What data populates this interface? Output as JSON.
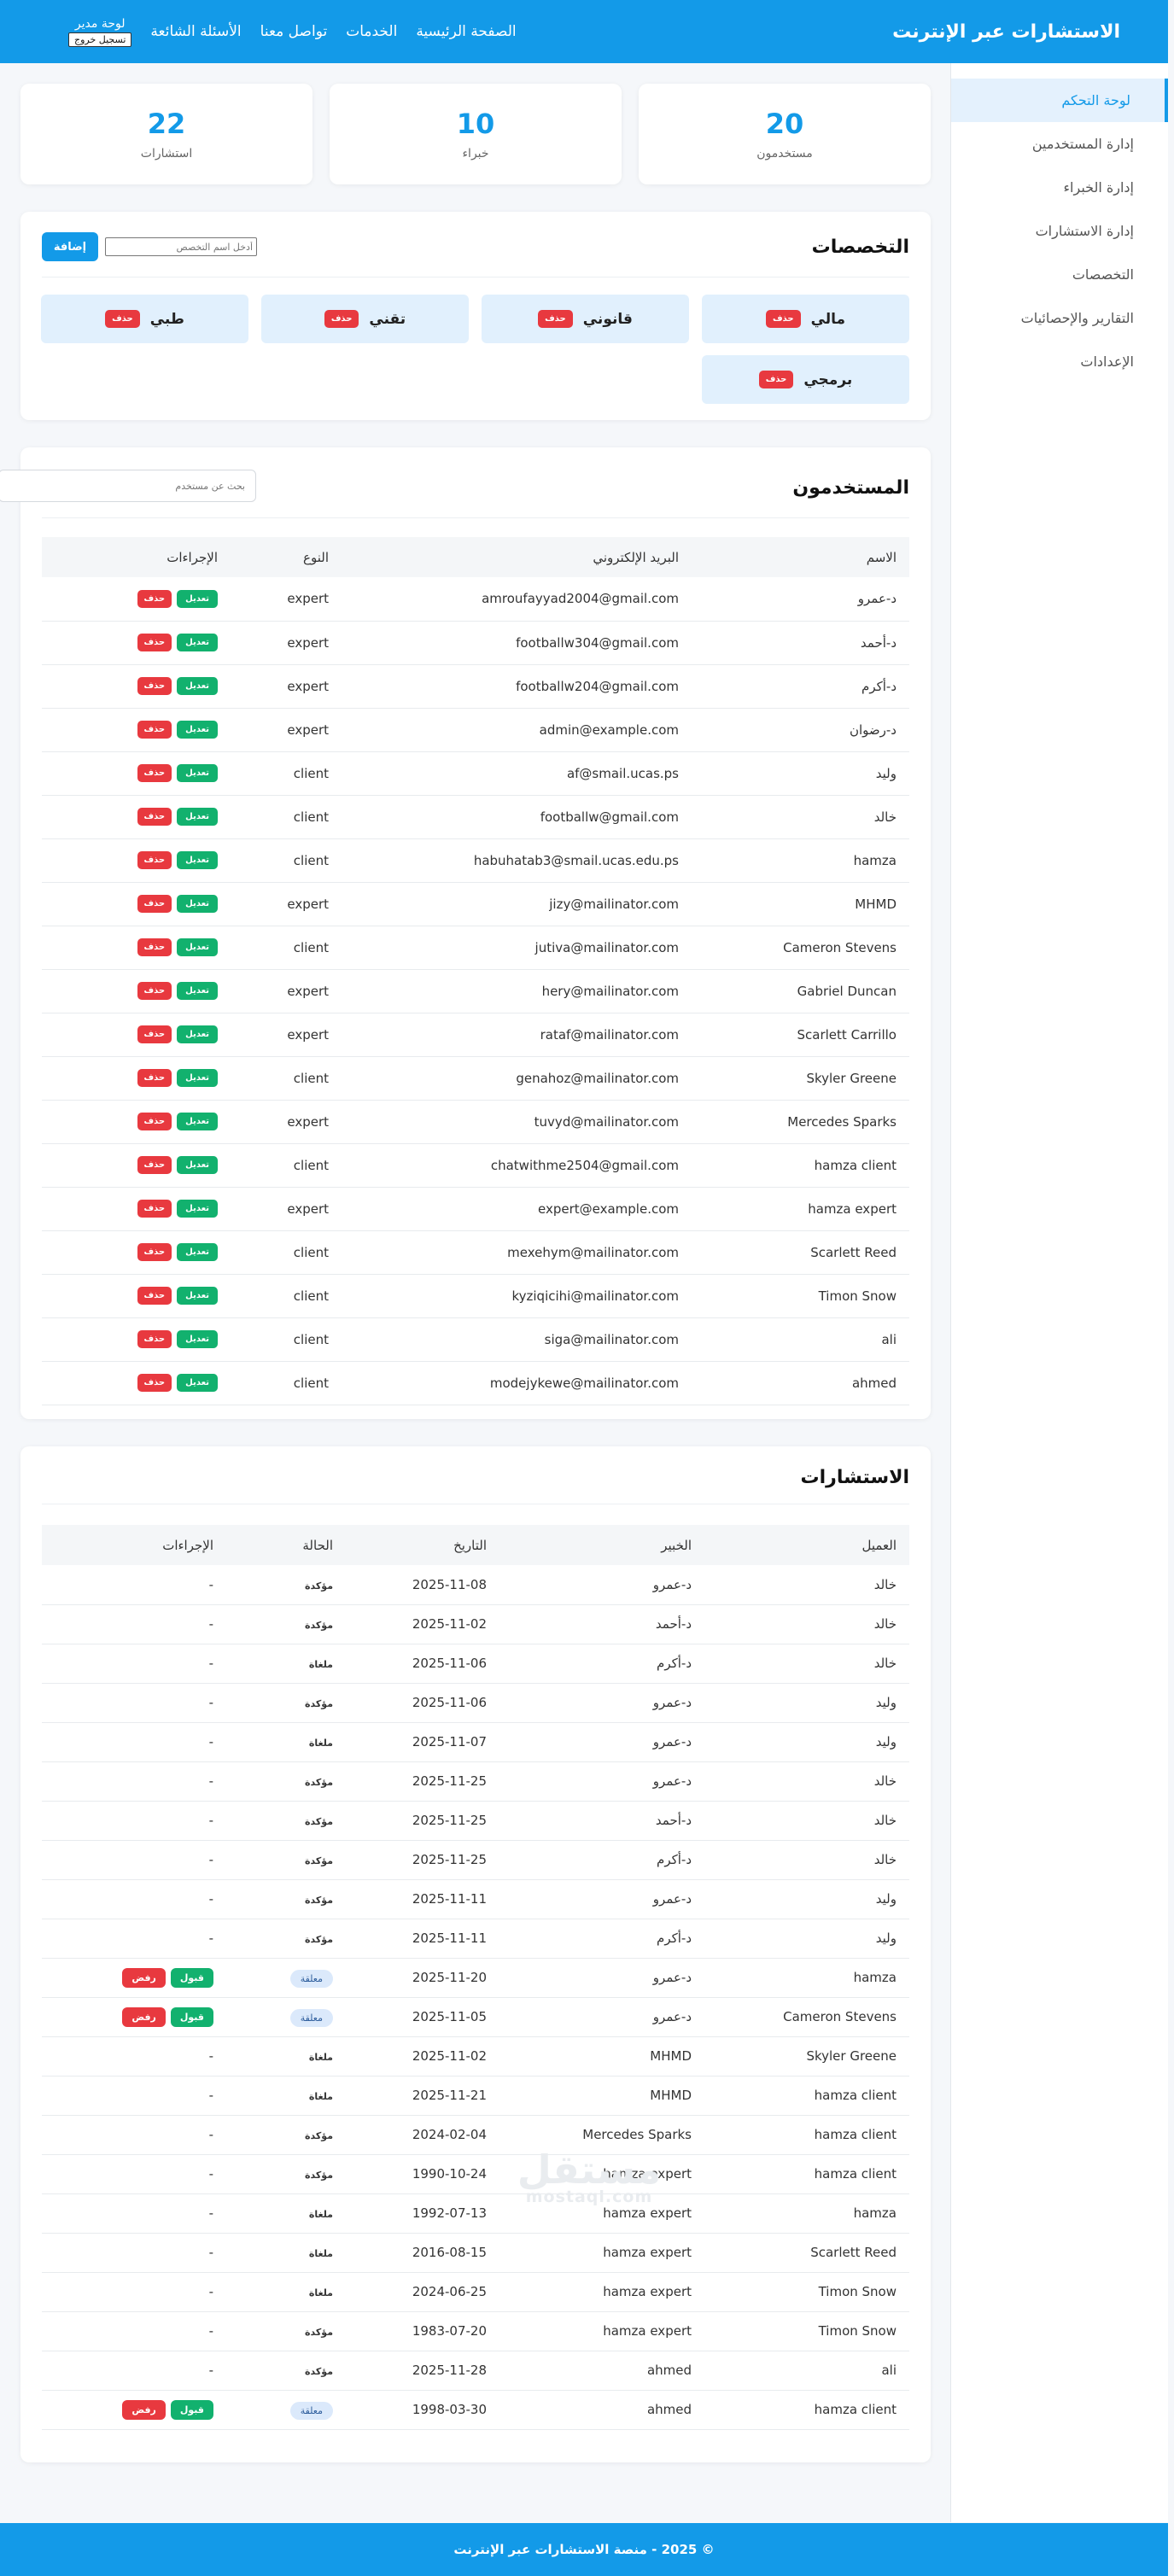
{
  "header": {
    "brand": "الاستشارات عبر الإنترنت",
    "nav": [
      "الصفحة الرئيسية",
      "الخدمات",
      "تواصل معنا",
      "الأسئلة الشائعة"
    ],
    "admin_label": "لوحة مدير",
    "logout": "تسجيل خروج"
  },
  "sidebar": {
    "items": [
      "لوحة التحكم",
      "إدارة المستخدمين",
      "إدارة الخبراء",
      "إدارة الاستشارات",
      "التخصصات",
      "التقارير والإحصائيات",
      "الإعدادات"
    ],
    "active": 0
  },
  "stats": [
    {
      "value": "20",
      "label": "مستخدمون"
    },
    {
      "value": "10",
      "label": "خبراء"
    },
    {
      "value": "22",
      "label": "استشارات"
    }
  ],
  "specialties": {
    "title": "التخصصات",
    "input_placeholder": "أدخل اسم التخصص",
    "add_label": "إضافة",
    "delete_label": "حذف",
    "items": [
      "مالي",
      "قانوني",
      "تقني",
      "طبي",
      "برمجي"
    ]
  },
  "users": {
    "title": "المستخدمون",
    "search_placeholder": "بحث عن مستخدم",
    "columns": [
      "الاسم",
      "البريد الإلكتروني",
      "النوع",
      "الإجراءات"
    ],
    "edit_label": "تعديل",
    "delete_label": "حذف",
    "rows": [
      [
        "د-عمرو",
        "amroufayyad2004@gmail.com",
        "expert"
      ],
      [
        "د-أحمد",
        "footballw304@gmail.com",
        "expert"
      ],
      [
        "د-أكرم",
        "footballw204@gmail.com",
        "expert"
      ],
      [
        "د-رضوان",
        "admin@example.com",
        "expert"
      ],
      [
        "وليد",
        "af@smail.ucas.ps",
        "client"
      ],
      [
        "خالد",
        "footballw@gmail.com",
        "client"
      ],
      [
        "hamza",
        "habuhatab3@smail.ucas.edu.ps",
        "client"
      ],
      [
        "MHMD",
        "jizy@mailinator.com",
        "expert"
      ],
      [
        "Cameron Stevens",
        "jutiva@mailinator.com",
        "client"
      ],
      [
        "Gabriel Duncan",
        "hery@mailinator.com",
        "expert"
      ],
      [
        "Scarlett Carrillo",
        "rataf@mailinator.com",
        "expert"
      ],
      [
        "Skyler Greene",
        "genahoz@mailinator.com",
        "client"
      ],
      [
        "Mercedes Sparks",
        "tuvyd@mailinator.com",
        "expert"
      ],
      [
        "hamza client",
        "chatwithme2504@gmail.com",
        "client"
      ],
      [
        "hamza expert",
        "expert@example.com",
        "expert"
      ],
      [
        "Scarlett Reed",
        "mexehym@mailinator.com",
        "client"
      ],
      [
        "Timon Snow",
        "kyziqicihi@mailinator.com",
        "client"
      ],
      [
        "ali",
        "siga@mailinator.com",
        "client"
      ],
      [
        "ahmed",
        "modejykewe@mailinator.com",
        "client"
      ]
    ]
  },
  "consultations": {
    "title": "الاستشارات",
    "columns": [
      "العميل",
      "الخبير",
      "التاريخ",
      "الحالة",
      "الإجراءات"
    ],
    "accept_label": "قبول",
    "reject_label": "رفض",
    "rows": [
      [
        "خالد",
        "د-عمرو",
        "2025-11-08",
        "مؤكدة",
        "-"
      ],
      [
        "خالد",
        "د-أحمد",
        "2025-11-02",
        "مؤكدة",
        "-"
      ],
      [
        "خالد",
        "د-أكرم",
        "2025-11-06",
        "ملغاة",
        "-"
      ],
      [
        "وليد",
        "د-عمرو",
        "2025-11-06",
        "مؤكدة",
        "-"
      ],
      [
        "وليد",
        "د-عمرو",
        "2025-11-07",
        "ملغاة",
        "-"
      ],
      [
        "خالد",
        "د-عمرو",
        "2025-11-25",
        "مؤكدة",
        "-"
      ],
      [
        "خالد",
        "د-أحمد",
        "2025-11-25",
        "مؤكدة",
        "-"
      ],
      [
        "خالد",
        "د-أكرم",
        "2025-11-25",
        "مؤكدة",
        "-"
      ],
      [
        "وليد",
        "د-عمرو",
        "2025-11-11",
        "مؤكدة",
        "-"
      ],
      [
        "وليد",
        "د-أكرم",
        "2025-11-11",
        "مؤكدة",
        "-"
      ],
      [
        "hamza",
        "د-عمرو",
        "2025-11-20",
        "معلقة",
        "buttons"
      ],
      [
        "Cameron Stevens",
        "د-عمرو",
        "2025-11-05",
        "معلقة",
        "buttons"
      ],
      [
        "Skyler Greene",
        "MHMD",
        "2025-11-02",
        "ملغاة",
        "-"
      ],
      [
        "hamza client",
        "MHMD",
        "2025-11-21",
        "ملغاة",
        "-"
      ],
      [
        "hamza client",
        "Mercedes Sparks",
        "2024-02-04",
        "مؤكدة",
        "-"
      ],
      [
        "hamza client",
        "hamza expert",
        "1990-10-24",
        "مؤكدة",
        "-"
      ],
      [
        "hamza",
        "hamza expert",
        "1992-07-13",
        "ملغاة",
        "-"
      ],
      [
        "Scarlett Reed",
        "hamza expert",
        "2016-08-15",
        "ملغاة",
        "-"
      ],
      [
        "Timon Snow",
        "hamza expert",
        "2024-06-25",
        "ملغاة",
        "-"
      ],
      [
        "Timon Snow",
        "hamza expert",
        "1983-07-20",
        "مؤكدة",
        "-"
      ],
      [
        "ali",
        "ahmed",
        "2025-11-28",
        "مؤكدة",
        "-"
      ],
      [
        "hamza client",
        "ahmed",
        "1998-03-30",
        "معلقة",
        "buttons"
      ]
    ]
  },
  "watermark": {
    "arabic": "مستقل",
    "latin": "mostaql.com"
  },
  "footer": "© 2025 - منصة الاستشارات عبر الإنترنت",
  "colors": {
    "primary": "#139ae8",
    "danger": "#e8393f",
    "success": "#12b16e",
    "pending_bg": "#dbe9fb"
  }
}
